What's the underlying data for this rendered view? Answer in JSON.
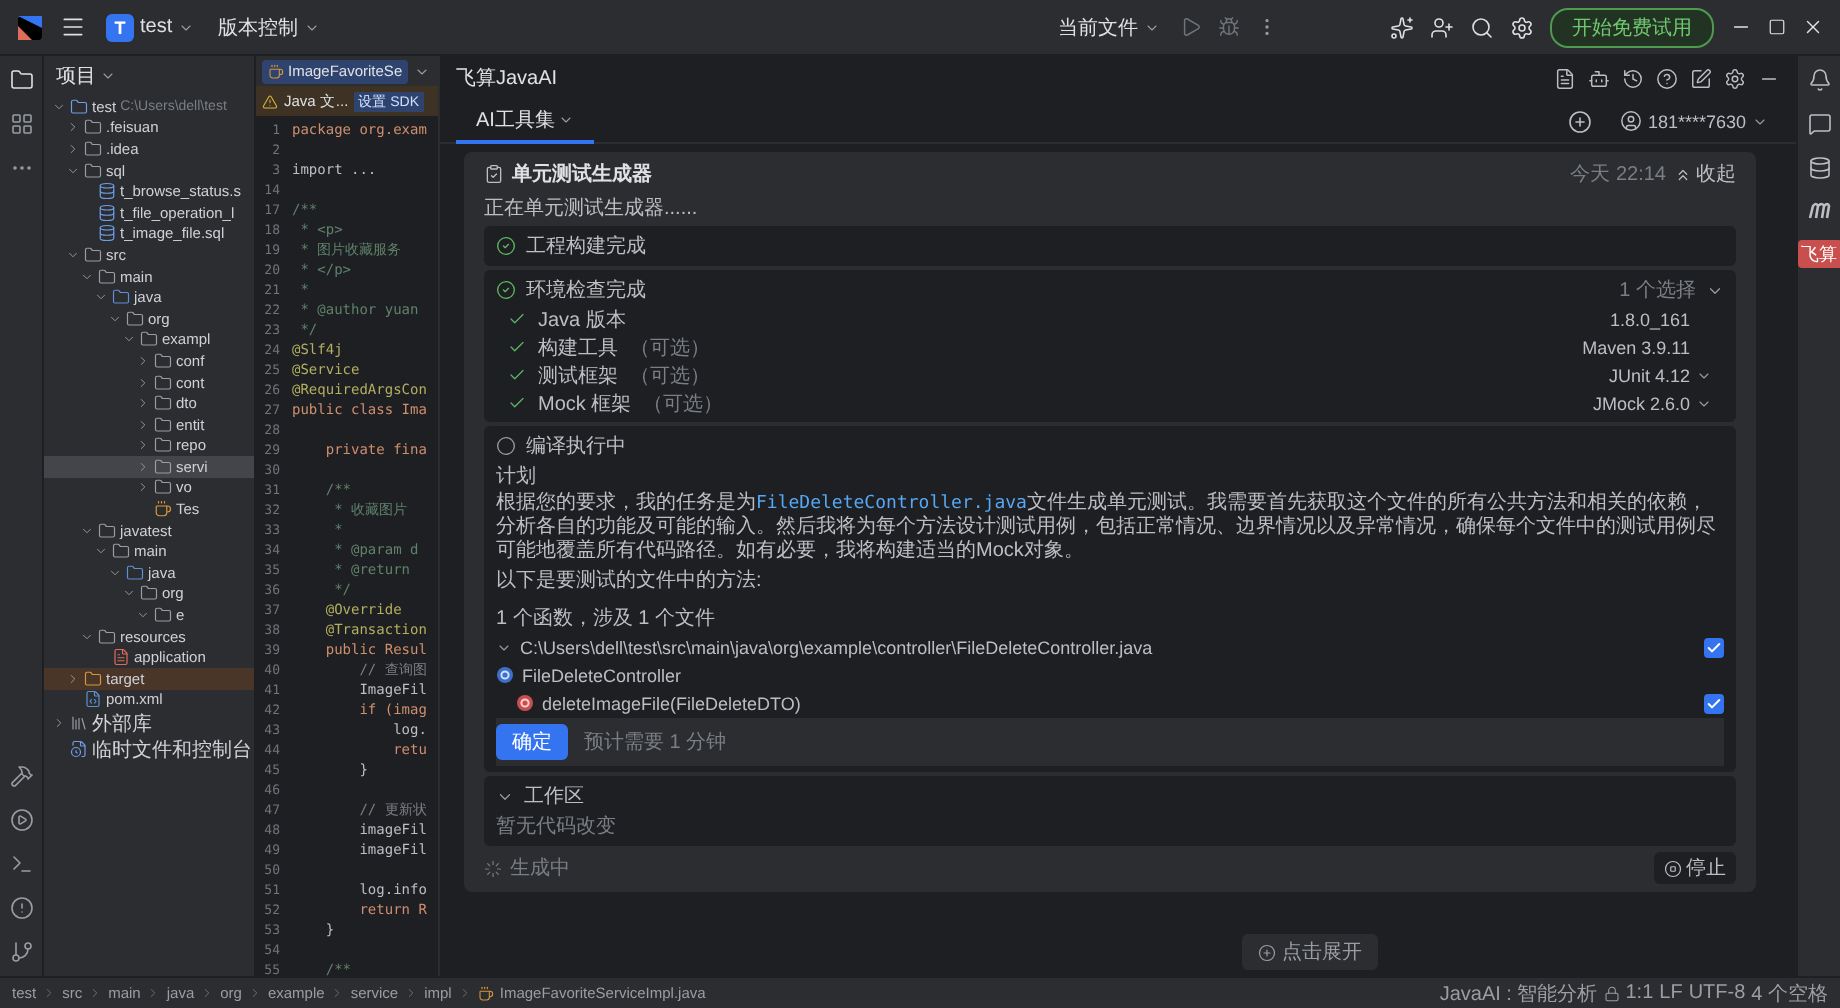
{
  "top_bar": {
    "project_initial": "T",
    "project": "test",
    "vcs": "版本控制",
    "run_config": "当前文件",
    "trial_button": "开始免费试用"
  },
  "project_panel": {
    "title": "项目",
    "tree": [
      {
        "name": "test",
        "path": "C:\\Users\\dell\\test",
        "kind": "module",
        "expanded": true,
        "selected": false,
        "children": [
          {
            "name": ".feisuan",
            "kind": "folder",
            "expanded": false,
            "selected": false
          },
          {
            "name": ".idea",
            "kind": "folder",
            "expanded": false,
            "selected": false
          },
          {
            "name": "sql",
            "kind": "folder",
            "expanded": true,
            "selected": false,
            "children": [
              {
                "name": "t_browse_status.s",
                "kind": "sql",
                "selected": false
              },
              {
                "name": "t_file_operation_l",
                "kind": "sql",
                "selected": false
              },
              {
                "name": "t_image_file.sql",
                "kind": "sql",
                "selected": false
              }
            ]
          },
          {
            "name": "src",
            "kind": "folder",
            "expanded": true,
            "selected": false,
            "children": [
              {
                "name": "main",
                "kind": "folder",
                "expanded": true,
                "selected": false,
                "children": [
                  {
                    "name": "java",
                    "kind": "source",
                    "expanded": true,
                    "selected": false,
                    "children": [
                      {
                        "name": "org",
                        "kind": "folder",
                        "expanded": true,
                        "selected": false,
                        "children": [
                          {
                            "name": "exampl",
                            "kind": "folder",
                            "expanded": true,
                            "selected": false,
                            "children": [
                              {
                                "name": "conf",
                                "kind": "folder",
                                "expanded": false,
                                "selected": false
                              },
                              {
                                "name": "cont",
                                "kind": "folder",
                                "expanded": false,
                                "selected": false
                              },
                              {
                                "name": "dto",
                                "kind": "folder",
                                "expanded": false,
                                "selected": false
                              },
                              {
                                "name": "entit",
                                "kind": "folder",
                                "expanded": false,
                                "selected": false
                              },
                              {
                                "name": "repo",
                                "kind": "folder",
                                "expanded": false,
                                "selected": false
                              },
                              {
                                "name": "servi",
                                "kind": "folder",
                                "expanded": false,
                                "selected": true
                              },
                              {
                                "name": "vo",
                                "kind": "folder",
                                "expanded": false,
                                "selected": false
                              },
                              {
                                "name": "Tes",
                                "kind": "java",
                                "selected": false
                              }
                            ]
                          }
                        ]
                      }
                    ]
                  }
                ]
              },
              {
                "name": "javatest",
                "kind": "folder",
                "expanded": true,
                "selected": false,
                "children": [
                  {
                    "name": "main",
                    "kind": "folder",
                    "expanded": true,
                    "selected": false,
                    "children": [
                      {
                        "name": "java",
                        "kind": "source",
                        "expanded": true,
                        "selected": false,
                        "children": [
                          {
                            "name": "org",
                            "kind": "folder",
                            "expanded": true,
                            "selected": false,
                            "children": [
                              {
                                "name": "e",
                                "kind": "folder",
                                "expanded": true,
                                "selected": false
                              }
                            ]
                          }
                        ]
                      }
                    ]
                  }
                ]
              },
              {
                "name": "resources",
                "kind": "folder",
                "expanded": true,
                "selected": false,
                "children": [
                  {
                    "name": "application",
                    "kind": "config",
                    "selected": false
                  }
                ]
              }
            ]
          },
          {
            "name": "target",
            "kind": "excluded",
            "expanded": false,
            "selected": false
          },
          {
            "name": "pom.xml",
            "kind": "maven",
            "selected": false
          }
        ]
      },
      {
        "name": "外部库",
        "kind": "library",
        "expanded": false,
        "selected": false
      },
      {
        "name": "临时文件和控制台",
        "kind": "scratch",
        "selected": false
      }
    ]
  },
  "editor": {
    "tab": "ImageFavoriteSe",
    "warning": {
      "text": "Java 文...",
      "action": "设置 SDK"
    },
    "lines": [
      {
        "n": "1",
        "kind": "keyword",
        "text": "package org.exam"
      },
      {
        "n": "2"
      },
      {
        "n": "3",
        "kind": "plain",
        "text": "import ..."
      },
      {
        "n": "14"
      },
      {
        "n": "17",
        "kind": "doc",
        "text": "/**"
      },
      {
        "n": "18",
        "kind": "doc",
        "text": " * <p>"
      },
      {
        "n": "19",
        "kind": "doc",
        "text": " * 图片收藏服务"
      },
      {
        "n": "20",
        "kind": "doc",
        "text": " * </p>"
      },
      {
        "n": "21",
        "kind": "doc",
        "text": " *"
      },
      {
        "n": "22",
        "kind": "doc",
        "text": " * @author yuan"
      },
      {
        "n": "23",
        "kind": "doc",
        "text": " */"
      },
      {
        "n": "24",
        "kind": "annotation",
        "text": "@Slf4j"
      },
      {
        "n": "25",
        "kind": "annotation",
        "text": "@Service"
      },
      {
        "n": "26",
        "kind": "annotation",
        "text": "@RequiredArgsCon"
      },
      {
        "n": "27",
        "kind": "keyword",
        "text": "public class Ima"
      },
      {
        "n": "28"
      },
      {
        "n": "29",
        "kind": "keyword",
        "text": "    private fina"
      },
      {
        "n": "30"
      },
      {
        "n": "31",
        "kind": "doc",
        "text": "    /**"
      },
      {
        "n": "32",
        "kind": "doc",
        "text": "     * 收藏图片"
      },
      {
        "n": "33",
        "kind": "doc",
        "text": "     *"
      },
      {
        "n": "34",
        "kind": "doc",
        "text": "     * @param d"
      },
      {
        "n": "35",
        "kind": "doc",
        "text": "     * @return"
      },
      {
        "n": "36",
        "kind": "doc",
        "text": "     */"
      },
      {
        "n": "37",
        "kind": "annotation",
        "text": "    @Override"
      },
      {
        "n": "38",
        "kind": "annotation",
        "text": "    @Transaction"
      },
      {
        "n": "39",
        "kind": "keyword",
        "text": "    public Resul"
      },
      {
        "n": "40",
        "kind": "comment",
        "text": "        // 查询图"
      },
      {
        "n": "41",
        "kind": "plain",
        "text": "        ImageFil"
      },
      {
        "n": "42",
        "kind": "keyword",
        "text": "        if (imag"
      },
      {
        "n": "43",
        "kind": "plain",
        "text": "            log."
      },
      {
        "n": "44",
        "kind": "keyword",
        "text": "            retu"
      },
      {
        "n": "45",
        "kind": "plain",
        "text": "        }"
      },
      {
        "n": "46"
      },
      {
        "n": "47",
        "kind": "comment",
        "text": "        // 更新状"
      },
      {
        "n": "48",
        "kind": "plain",
        "text": "        imageFil"
      },
      {
        "n": "49",
        "kind": "plain",
        "text": "        imageFil"
      },
      {
        "n": "50"
      },
      {
        "n": "51",
        "kind": "plain",
        "text": "        log.info"
      },
      {
        "n": "52",
        "kind": "keyword",
        "text": "        return R"
      },
      {
        "n": "53",
        "kind": "plain",
        "text": "    }"
      },
      {
        "n": "54"
      },
      {
        "n": "55",
        "kind": "doc",
        "text": "    /**"
      }
    ]
  },
  "ai_panel": {
    "title": "飞算JavaAI",
    "tab": {
      "label": "AI工具集",
      "selected": true
    },
    "account": "181****7630",
    "card": {
      "title": "单元测试生成器",
      "time": "今天 22:14",
      "collapse": "收起",
      "status": "正在单元测试生成器......",
      "steps": [
        {
          "kind": "done",
          "label": "工程构建完成"
        },
        {
          "kind": "done",
          "label": "环境检查完成",
          "summary": "1 个选择",
          "expanded": true,
          "checks": [
            {
              "label": "Java 版本",
              "value": "1.8.0_161",
              "dropdown": false
            },
            {
              "label": "构建工具",
              "note": "（可选）",
              "value": "Maven 3.9.11",
              "dropdown": false
            },
            {
              "label": "测试框架",
              "note": "（可选）",
              "value": "JUnit 4.12",
              "dropdown": true
            },
            {
              "label": "Mock 框架",
              "note": "（可选）",
              "value": "JMock 2.6.0",
              "dropdown": true
            }
          ]
        },
        {
          "kind": "running",
          "label": "编译执行中",
          "plan": {
            "heading": "计划",
            "paragraph": {
              "before": "根据您的要求，我的任务是为",
              "code": "FileDeleteController.java",
              "after": "文件生成单元测试。我需要首先获取这个文件的所有公共方法和相关的依赖，分析各自的功能及可能的输入。然后我将为每个方法设计测试用例，包括正常情况、边界情况以及异常情况，确保每个文件中的测试用例尽可能地覆盖所有代码路径。如有必要，我将构建适当的Mock对象。"
            },
            "intro": "以下是要测试的文件中的方法:",
            "count": "1 个函数，涉及 1 个文件",
            "file": {
              "path": "C:\\Users\\dell\\test\\src\\main\\java\\org\\example\\controller\\FileDeleteController.java",
              "expanded": true,
              "checked": true
            },
            "class": "FileDeleteController",
            "methods": [
              {
                "name": "deleteImageFile(FileDeleteDTO)",
                "checked": true
              }
            ],
            "confirm": "确定",
            "estimate": "预计需要 1 分钟"
          }
        }
      ],
      "workspace": {
        "title": "工作区",
        "expanded": true,
        "note": "暂无代码改变"
      },
      "input": {
        "status": "生成中",
        "stop": "停止"
      }
    },
    "expand_button": "点击展开"
  },
  "right_strip": {
    "badge": "飞算"
  },
  "status_bar": {
    "breadcrumbs": [
      "test",
      "src",
      "main",
      "java",
      "org",
      "example",
      "service",
      "impl",
      "ImageFavoriteServiceImpl.java"
    ],
    "plugin": "JavaAI : 智能分析",
    "position": "1:1",
    "line_ending": "LF",
    "encoding": "UTF-8",
    "indent": "4 个空格"
  }
}
